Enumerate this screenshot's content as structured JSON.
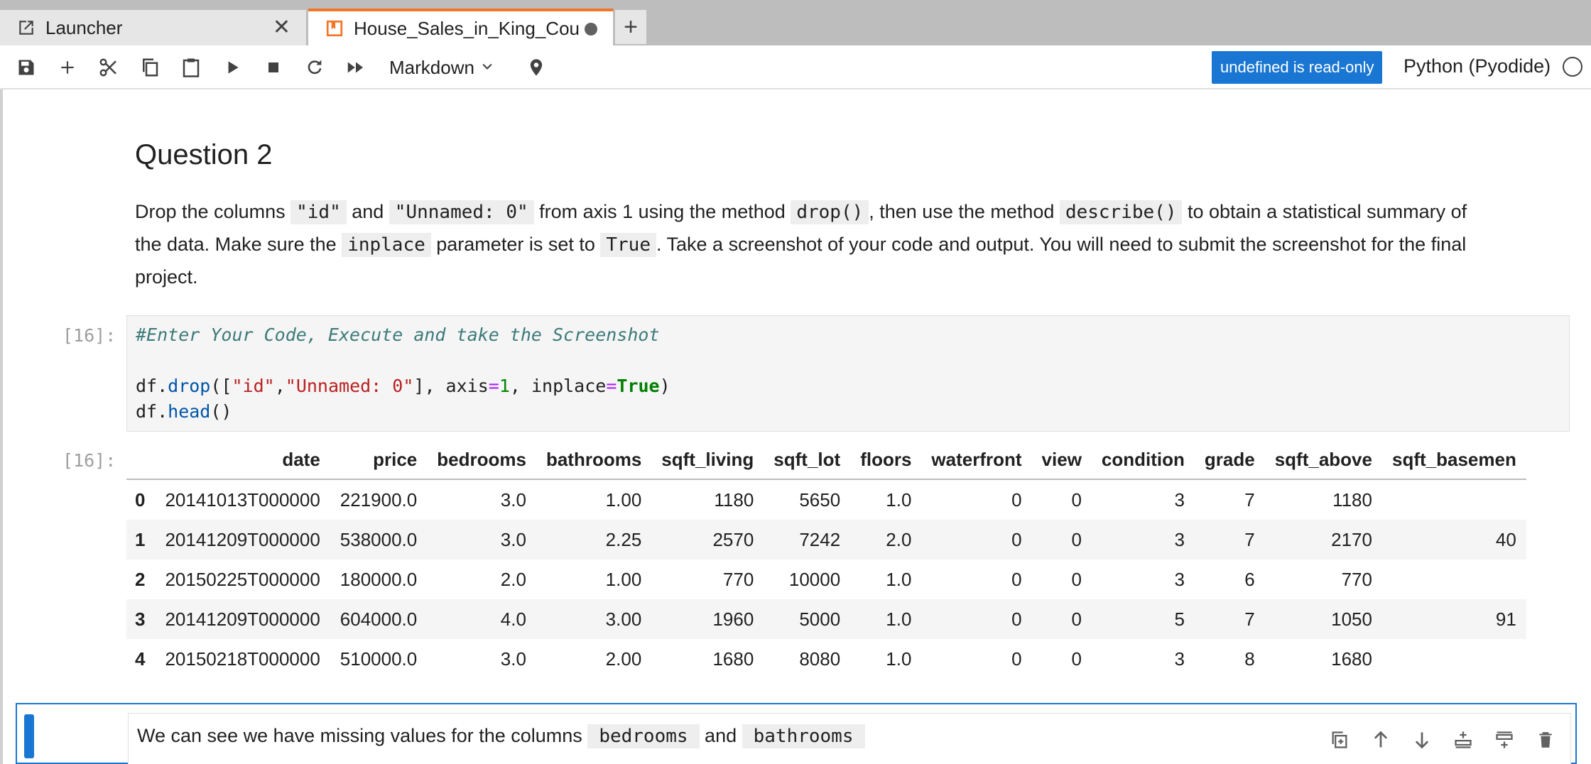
{
  "tabs": [
    {
      "label": "Launcher",
      "icon": "external-link-icon",
      "closable": true,
      "active": false
    },
    {
      "label": "House_Sales_in_King_Cou",
      "icon": "notebook-icon",
      "unsaved": true,
      "active": true
    }
  ],
  "toolbar": {
    "icons": [
      "save-icon",
      "add-icon",
      "cut-icon",
      "copy-icon",
      "paste-icon",
      "run-icon",
      "stop-icon",
      "restart-icon",
      "fast-forward-icon"
    ],
    "cell_type": "Markdown",
    "readonly_badge": "undefined is read-only",
    "kernel_name": "Python (Pyodide)"
  },
  "notebook": {
    "question_title": "Question 2",
    "para": {
      "t1": "Drop the columns ",
      "c1": "\"id\"",
      "t2": " and ",
      "c2": "\"Unnamed: 0\"",
      "t3": " from axis 1 using the method ",
      "c3": "drop()",
      "t4": ", then use the method ",
      "c4": "describe()",
      "t5": " to obtain a statistical summary of the data. Make sure the ",
      "c5": "inplace",
      "t6": " parameter is set to ",
      "c6": "True",
      "t7": ". Take a screenshot of your code and output. You will need to submit the screenshot for the final project."
    },
    "code_prompt": "[16]:",
    "code": {
      "comment": "#Enter Your Code, Execute and take the Screenshot",
      "l2": {
        "a": "df.",
        "fn": "drop",
        "b": "([",
        "s1": "\"id\"",
        "c": ",",
        "s2": "\"Unnamed: 0\"",
        "d": "], axis",
        "eq1": "=",
        "n1": "1",
        "e": ", inplace",
        "eq2": "=",
        "kw": "True",
        "f": ")"
      },
      "l3": {
        "a": "df.",
        "fn": "head",
        "b": "()"
      }
    },
    "output_prompt": "[16]:",
    "dataframe": {
      "columns": [
        "",
        "date",
        "price",
        "bedrooms",
        "bathrooms",
        "sqft_living",
        "sqft_lot",
        "floors",
        "waterfront",
        "view",
        "condition",
        "grade",
        "sqft_above",
        "sqft_basemen"
      ],
      "rows": [
        [
          "0",
          "20141013T000000",
          "221900.0",
          "3.0",
          "1.00",
          "1180",
          "5650",
          "1.0",
          "0",
          "0",
          "3",
          "7",
          "1180",
          ""
        ],
        [
          "1",
          "20141209T000000",
          "538000.0",
          "3.0",
          "2.25",
          "2570",
          "7242",
          "2.0",
          "0",
          "0",
          "3",
          "7",
          "2170",
          "40"
        ],
        [
          "2",
          "20150225T000000",
          "180000.0",
          "2.0",
          "1.00",
          "770",
          "10000",
          "1.0",
          "0",
          "0",
          "3",
          "6",
          "770",
          ""
        ],
        [
          "3",
          "20141209T000000",
          "604000.0",
          "4.0",
          "3.00",
          "1960",
          "5000",
          "1.0",
          "0",
          "0",
          "5",
          "7",
          "1050",
          "91"
        ],
        [
          "4",
          "20150218T000000",
          "510000.0",
          "3.0",
          "2.00",
          "1680",
          "8080",
          "1.0",
          "0",
          "0",
          "3",
          "8",
          "1680",
          ""
        ]
      ]
    },
    "active_cell": {
      "t1": "We can see we have missing values for the columns ",
      "c1": "bedrooms",
      "t2": " and ",
      "c2": "bathrooms"
    },
    "cell_tool_icons": [
      "duplicate-icon",
      "move-up-icon",
      "move-down-icon",
      "insert-above-icon",
      "insert-below-icon",
      "delete-icon"
    ]
  },
  "colors": {
    "accent": "#1976d2",
    "tab_active_border": "#f37626"
  }
}
